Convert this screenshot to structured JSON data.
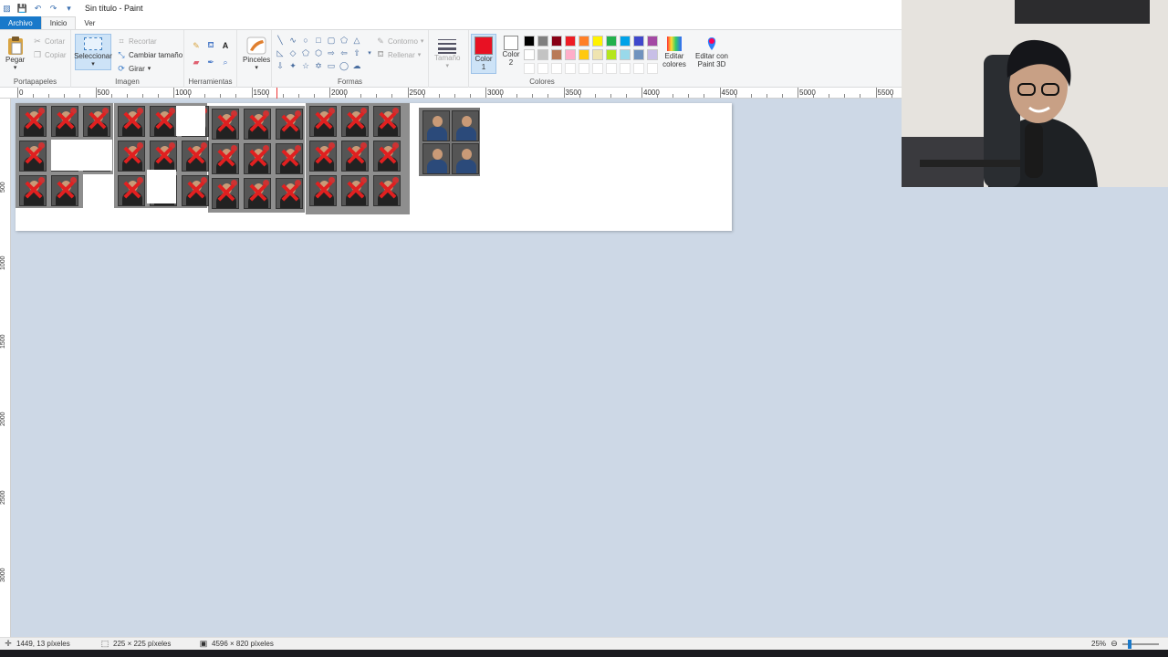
{
  "window": {
    "title": "Sin título - Paint"
  },
  "tabs": [
    "Archivo",
    "Inicio",
    "Ver"
  ],
  "ribbon": {
    "clipboard": {
      "label": "Portapapeles",
      "paste": "Pegar",
      "cut": "Cortar",
      "copy": "Copiar"
    },
    "image": {
      "label": "Imagen",
      "select": "Seleccionar",
      "crop": "Recortar",
      "resize": "Cambiar tamaño",
      "rotate": "Girar"
    },
    "tools": {
      "label": "Herramientas"
    },
    "brushes": {
      "label": "Pinceles"
    },
    "shapes": {
      "label": "Formas",
      "outline": "Contorno",
      "fill": "Rellenar"
    },
    "size": {
      "label": "Tamaño"
    },
    "colors": {
      "label": "Colores",
      "color1": "Color 1",
      "color2": "Color 2",
      "edit": "Editar colores",
      "paint3d": "Editar con Paint 3D",
      "color1_value": "#e81123",
      "color2_value": "#ffffff",
      "palette_row1": [
        "#000000",
        "#7f7f7f",
        "#880015",
        "#ed1c24",
        "#ff7f27",
        "#fff200",
        "#22b14c",
        "#00a2e8",
        "#3f48cc",
        "#a349a4"
      ],
      "palette_row2": [
        "#ffffff",
        "#c3c3c3",
        "#b97a57",
        "#ffaec9",
        "#ffc90e",
        "#efe4b0",
        "#b5e61d",
        "#99d9ea",
        "#7092be",
        "#c8bfe7"
      ]
    }
  },
  "ruler": {
    "h_labels": [
      "0",
      "500",
      "1000",
      "1500",
      "2000",
      "2500",
      "3000",
      "3500",
      "4000",
      "4500",
      "5000",
      "5500"
    ],
    "v_labels": [
      "500",
      "1000",
      "1500",
      "2000",
      "2500",
      "3000"
    ]
  },
  "status": {
    "cursor": "1449, 13 píxeles",
    "selection": "225 × 225 píxeles",
    "image_size": "4596 × 820 píxeles",
    "zoom": "25%"
  }
}
